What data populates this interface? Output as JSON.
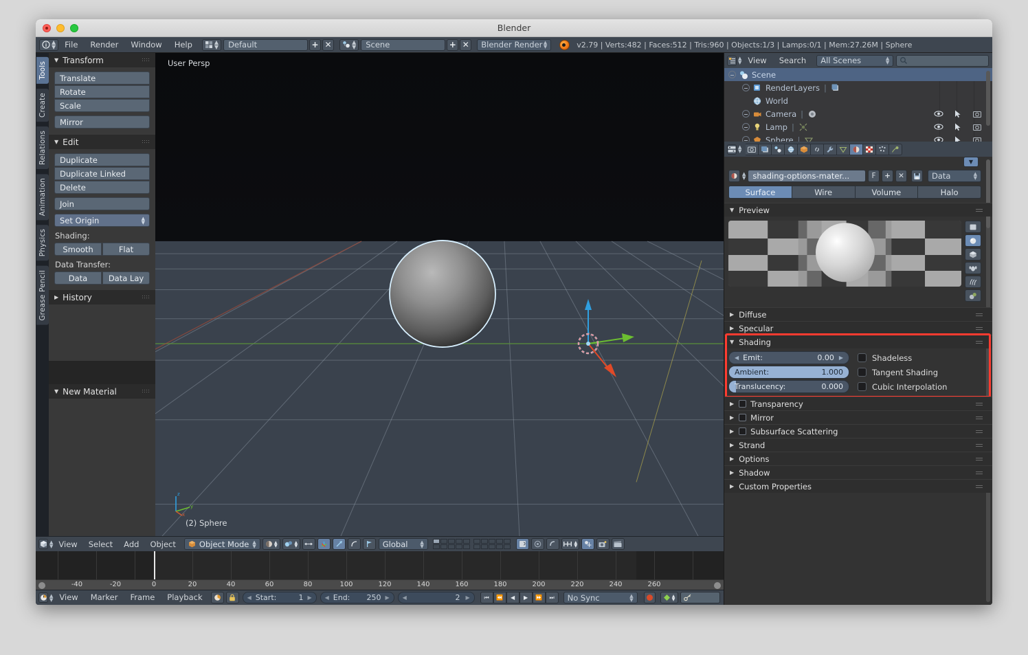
{
  "window": {
    "title": "Blender"
  },
  "menubar": {
    "menus": [
      "File",
      "Render",
      "Window",
      "Help"
    ],
    "screen_layout": "Default",
    "scene_name": "Scene",
    "engine": "Blender Render",
    "stats": "v2.79 | Verts:482 | Faces:512 | Tris:960 | Objects:1/3 | Lamps:0/1 | Mem:27.26M | Sphere",
    "add_label": "+",
    "remove_label": "✕"
  },
  "toolshelf": {
    "tabs": [
      "Tools",
      "Create",
      "Relations",
      "Animation",
      "Physics",
      "Grease Pencil"
    ],
    "active_tab": "Tools",
    "transform": {
      "title": "Transform",
      "buttons": [
        "Translate",
        "Rotate",
        "Scale",
        "Mirror"
      ]
    },
    "edit": {
      "title": "Edit",
      "buttons": [
        "Duplicate",
        "Duplicate Linked",
        "Delete",
        "Join"
      ],
      "set_origin": "Set Origin",
      "shading_label": "Shading:",
      "shading_buttons": [
        "Smooth",
        "Flat"
      ],
      "data_transfer_label": "Data Transfer:",
      "data_buttons": [
        "Data",
        "Data Lay"
      ]
    },
    "history": {
      "title": "History"
    },
    "new_material": {
      "title": "New Material"
    }
  },
  "viewport": {
    "persp_label": "User Persp",
    "object_label": "(2) Sphere",
    "axis": {
      "x": "x",
      "y": "y",
      "z": "z"
    },
    "header": {
      "menus": [
        "View",
        "Select",
        "Add",
        "Object"
      ],
      "mode": "Object Mode",
      "orientation": "Global"
    }
  },
  "timeline": {
    "header_menus": [
      "View",
      "Marker",
      "Frame",
      "Playback"
    ],
    "start_label": "Start:",
    "start_value": "1",
    "end_label": "End:",
    "end_value": "250",
    "current_frame": "2",
    "sync_mode": "No Sync",
    "ruler_ticks": [
      "-40",
      "-20",
      "0",
      "20",
      "40",
      "60",
      "80",
      "100",
      "120",
      "140",
      "160",
      "180",
      "200",
      "220",
      "240",
      "260"
    ],
    "transport": [
      "⏮",
      "⏪",
      "◀",
      "▶",
      "⏩",
      "⏭"
    ]
  },
  "outliner": {
    "header": {
      "view": "View",
      "search": "Search",
      "filter": "All Scenes",
      "search_value": ""
    },
    "rows": [
      {
        "label": "Scene",
        "indent": 0,
        "selected": true,
        "expand": true,
        "icon": "scene-icon"
      },
      {
        "label": "RenderLayers",
        "indent": 1,
        "selected": false,
        "expand": true,
        "icon": "renderlayers-icon"
      },
      {
        "label": "World",
        "indent": 1,
        "selected": false,
        "expand": false,
        "icon": "world-icon"
      },
      {
        "label": "Camera",
        "indent": 1,
        "selected": false,
        "expand": true,
        "icon": "camera-icon"
      },
      {
        "label": "Lamp",
        "indent": 1,
        "selected": false,
        "expand": true,
        "icon": "lamp-icon"
      },
      {
        "label": "Sphere",
        "indent": 1,
        "selected": false,
        "expand": true,
        "icon": "mesh-icon"
      }
    ]
  },
  "properties": {
    "material_name": "shading-options-mater...",
    "f_label": "F",
    "add_label": "+",
    "remove_label": "✕",
    "data_source": "Data",
    "segments": [
      "Surface",
      "Wire",
      "Volume",
      "Halo"
    ],
    "active_segment": "Surface",
    "preview": {
      "title": "Preview"
    },
    "sections_above": [
      {
        "label": "Diffuse",
        "open": false,
        "checkbox": false
      },
      {
        "label": "Specular",
        "open": false,
        "checkbox": false
      }
    ],
    "shading": {
      "title": "Shading",
      "open": true,
      "highlighted": true,
      "highlight_color": "#ff3b30",
      "sliders": [
        {
          "label": "Emit:",
          "value": "0.00",
          "fill_pct": 0
        },
        {
          "label": "Ambient:",
          "value": "1.000",
          "fill_pct": 100
        },
        {
          "label": "Translucency:",
          "value": "0.000",
          "fill_pct": 6
        }
      ],
      "checkboxes": [
        {
          "label": "Shadeless",
          "checked": false
        },
        {
          "label": "Tangent Shading",
          "checked": false
        },
        {
          "label": "Cubic Interpolation",
          "checked": false
        }
      ]
    },
    "sections_below": [
      {
        "label": "Transparency",
        "open": false,
        "checkbox": true
      },
      {
        "label": "Mirror",
        "open": false,
        "checkbox": true
      },
      {
        "label": "Subsurface Scattering",
        "open": false,
        "checkbox": true
      },
      {
        "label": "Strand",
        "open": false,
        "checkbox": false
      },
      {
        "label": "Options",
        "open": false,
        "checkbox": false
      },
      {
        "label": "Shadow",
        "open": false,
        "checkbox": false
      },
      {
        "label": "Custom Properties",
        "open": false,
        "checkbox": false
      }
    ]
  }
}
